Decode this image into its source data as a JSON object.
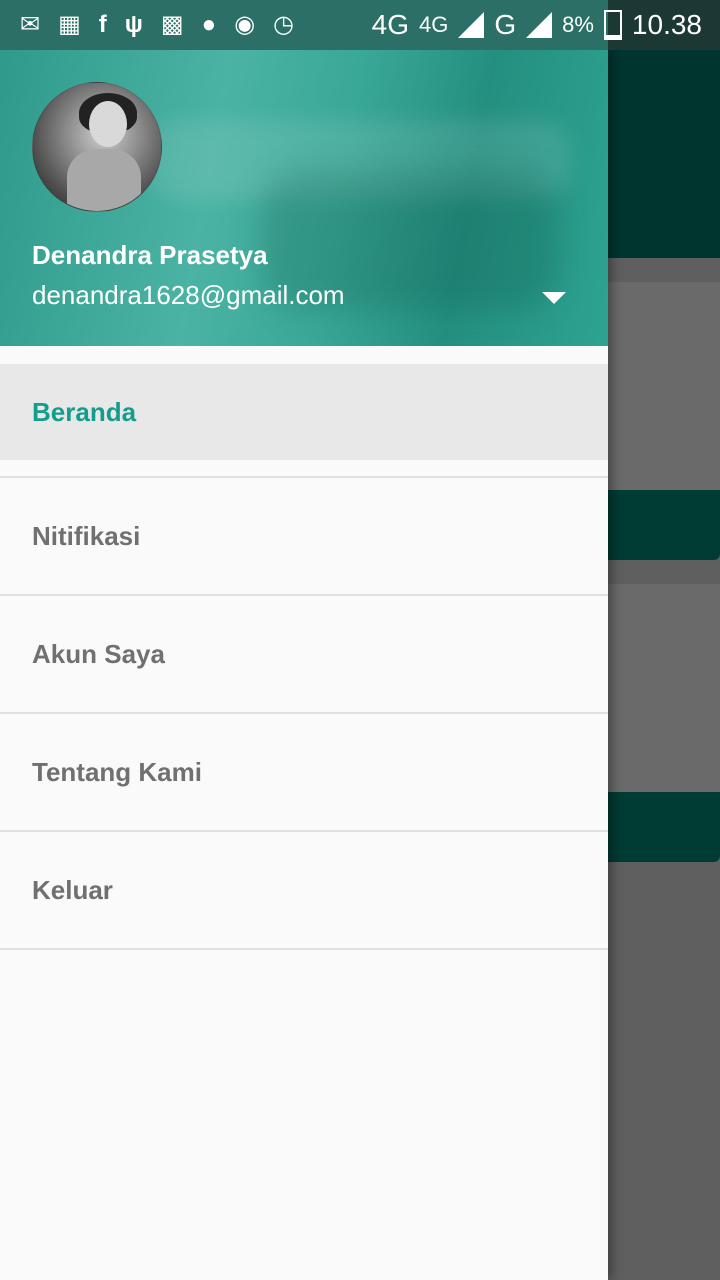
{
  "status_bar": {
    "network": "4G",
    "network_small": "4G",
    "network2": "G",
    "battery": "8%",
    "time": "10.38",
    "icons": [
      "messages-icon",
      "gallery-icon",
      "facebook-icon",
      "usb-icon",
      "bbm-icon",
      "line-icon",
      "hotspot-icon",
      "alarm-icon"
    ]
  },
  "drawer": {
    "user": {
      "name": "Denandra Prasetya",
      "email": "denandra1628@gmail.com"
    },
    "menu": [
      {
        "label": "Beranda",
        "active": true
      },
      {
        "label": "Nitifikasi",
        "active": false
      },
      {
        "label": "Akun Saya",
        "active": false
      },
      {
        "label": "Tentang Kami",
        "active": false
      },
      {
        "label": "Keluar",
        "active": false
      }
    ]
  },
  "colors": {
    "accent": "#139d8c",
    "header": "#3aa897",
    "toolbar_dim": "#00352f"
  }
}
